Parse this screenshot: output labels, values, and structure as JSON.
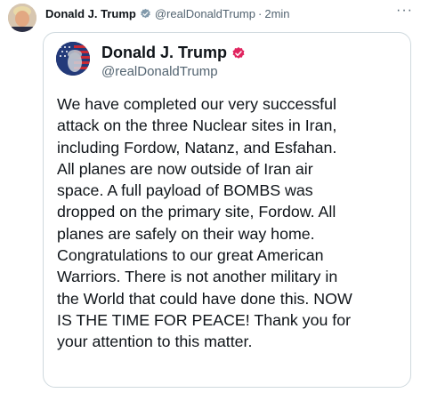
{
  "outer": {
    "name": "Donald J. Trump",
    "handle": "@realDonaldTrump",
    "separator": "·",
    "time": "2min",
    "more": "···"
  },
  "quoted": {
    "name": "Donald J. Trump",
    "handle": "@realDonaldTrump",
    "text_lines": [
      "We have completed our very successful",
      "attack on the three Nuclear sites in Iran,",
      "including Fordow, Natanz, and Esfahan.",
      "All planes are now outside of Iran air",
      "space. A full payload of BOMBS was",
      "dropped on the primary site, Fordow. All",
      "planes are safely on their way home.",
      "Congratulations to our great American",
      "Warriors. There is not another military in",
      "the World that could have done this. NOW",
      "IS THE TIME FOR PEACE! Thank you for",
      "your attention to this matter."
    ]
  },
  "colors": {
    "text": "#0f1419",
    "muted": "#536471",
    "border": "#cfd9de",
    "verified_gray": "#829aab",
    "verified_pink": "#e0245e"
  },
  "icons": {
    "outer_verified": "verified-badge-icon",
    "quoted_verified": "verified-badge-icon",
    "more": "more-options-icon"
  }
}
